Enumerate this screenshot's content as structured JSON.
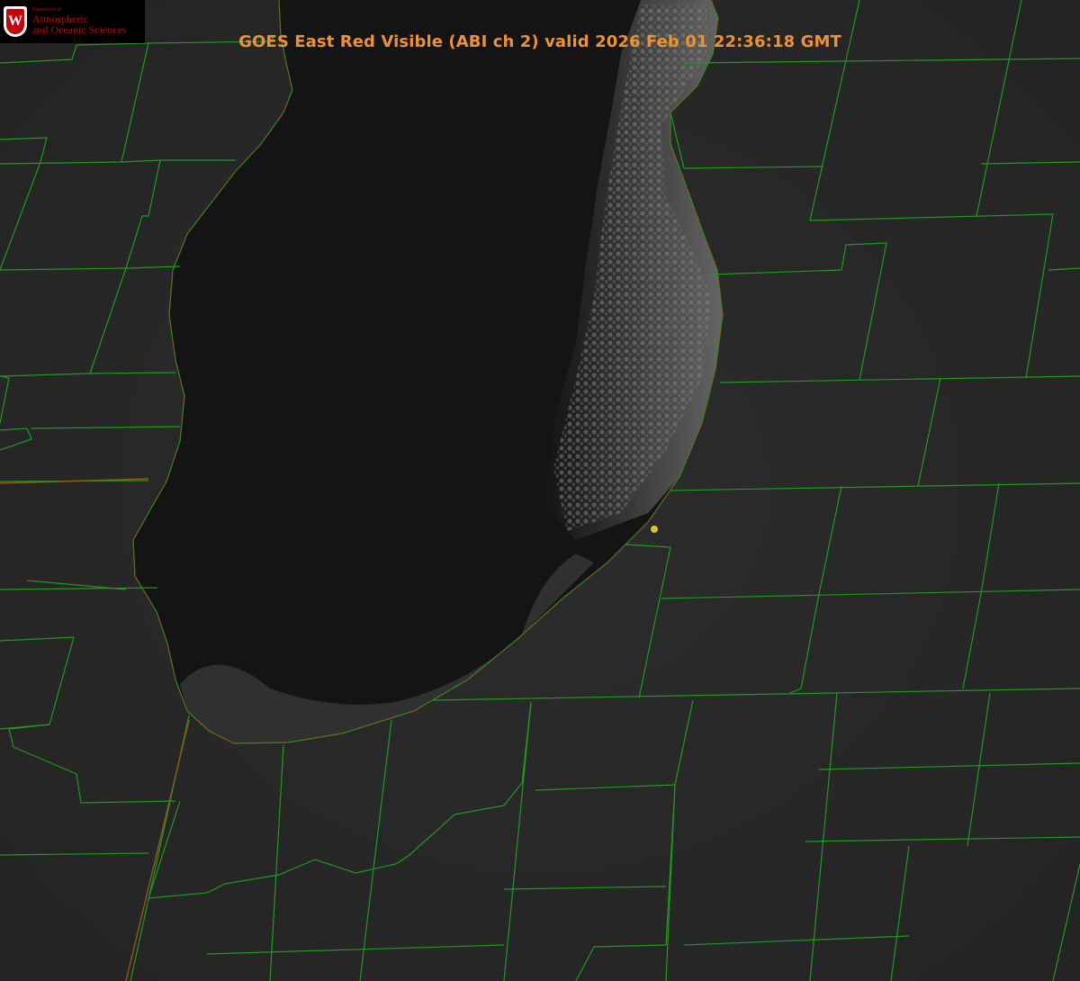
{
  "title": "GOES East Red Visible (ABI ch 2) valid 2026 Feb 01 22:36:18 GMT",
  "logo": {
    "department": "Department of",
    "line1": "Atmospheric",
    "line2": "and Oceanic Sciences",
    "crest_letter": "W",
    "icon": "uw-crest-icon"
  },
  "colors": {
    "land": "#2a2a2a",
    "lake": "#141414",
    "county_lines": "#1f9a1f",
    "state_line": "#c0392b",
    "shoreline_dotted": "#d02020",
    "title": "#f0922b",
    "marker": "#d8c81e",
    "brand": "#c5050c"
  }
}
